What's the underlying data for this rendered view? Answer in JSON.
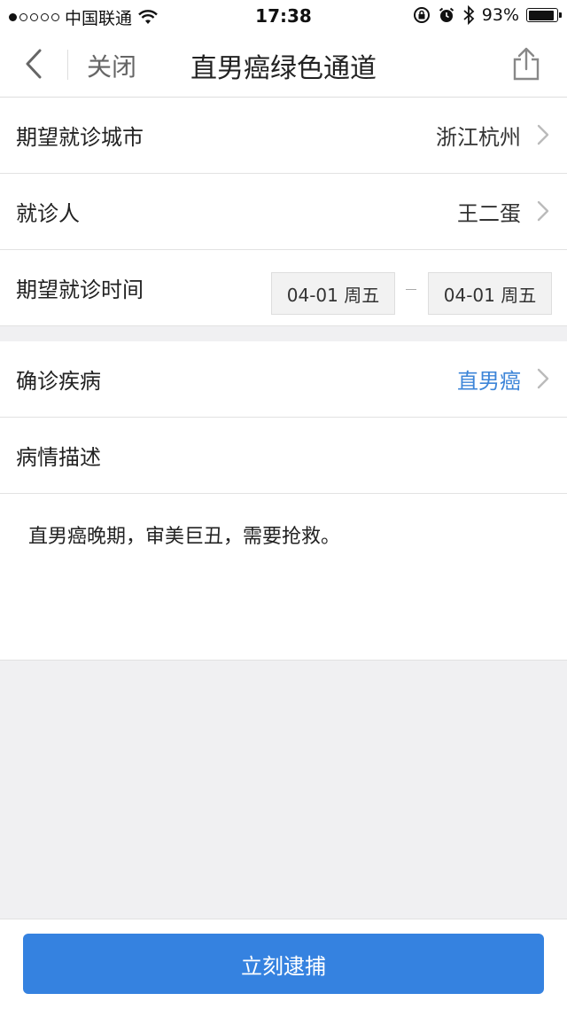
{
  "status_bar": {
    "carrier": "中国联通",
    "time": "17:38",
    "battery": "93%",
    "battery_level": 0.93
  },
  "nav": {
    "close_label": "关闭",
    "title": "直男癌绿色通道"
  },
  "form": {
    "city": {
      "label": "期望就诊城市",
      "value": "浙江杭州"
    },
    "patient": {
      "label": "就诊人",
      "value": "王二蛋"
    },
    "time": {
      "label": "期望就诊时间",
      "start": "04-01 周五",
      "end": "04-01 周五"
    },
    "disease": {
      "label": "确诊疾病",
      "value": "直男癌"
    },
    "description": {
      "label": "病情描述",
      "value": "直男癌晚期，审美巨丑，需要抢救。"
    }
  },
  "footer": {
    "submit_label": "立刻逮捕"
  },
  "colors": {
    "accent": "#3582e0",
    "link_blue": "#3d85d8",
    "background": "#f0f0f2"
  }
}
